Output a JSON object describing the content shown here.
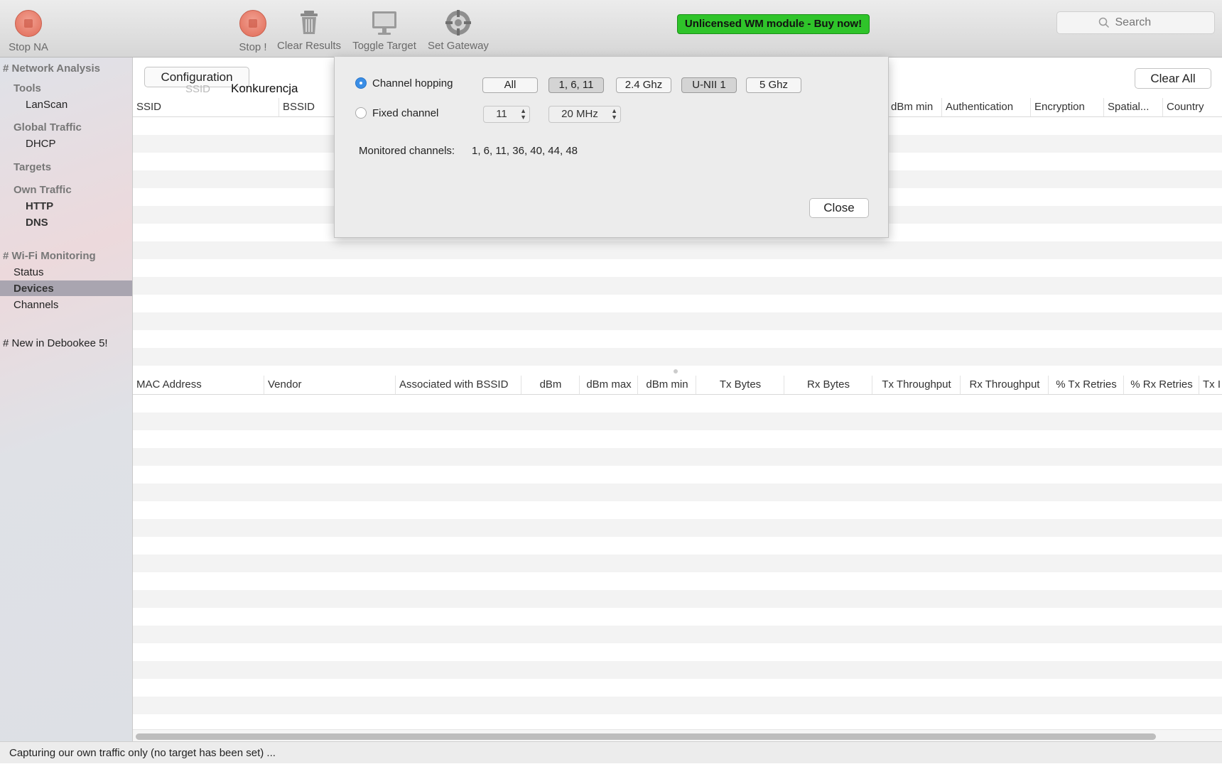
{
  "toolbar": {
    "stop_na": "Stop NA",
    "stop": "Stop !",
    "clear_results": "Clear Results",
    "toggle_target": "Toggle Target",
    "set_gateway": "Set Gateway",
    "license_banner": "Unlicensed WM module - Buy now!",
    "search_placeholder": "Search"
  },
  "sidebar": {
    "network_analysis": "# Network Analysis",
    "tools": "Tools",
    "lanscan": "LanScan",
    "global_traffic": "Global Traffic",
    "dhcp": "DHCP",
    "targets": "Targets",
    "own_traffic": "Own Traffic",
    "http": "HTTP",
    "dns": "DNS",
    "wifi_monitoring": "# Wi-Fi Monitoring",
    "status": "Status",
    "devices": "Devices",
    "channels": "Channels",
    "new_in": "# New in Debookee 5!"
  },
  "main": {
    "configuration": "Configuration",
    "clear_all": "Clear All",
    "tab_ssid": "SSID",
    "tab_name": "Konkurencja",
    "top_table": {
      "columns": [
        "SSID",
        "BSSID",
        "dBm min",
        "Authentication",
        "Encryption",
        "Spatial...",
        "Country"
      ]
    },
    "bottom_table": {
      "columns": [
        "MAC Address",
        "Vendor",
        "Associated with BSSID",
        "dBm",
        "dBm max",
        "dBm min",
        "Tx Bytes",
        "Rx Bytes",
        "Tx Throughput",
        "Rx Throughput",
        "% Tx Retries",
        "% Rx Retries",
        "Tx I"
      ]
    }
  },
  "popover": {
    "channel_hopping": "Channel hopping",
    "fixed_channel": "Fixed channel",
    "chips": [
      "All",
      "1, 6, 11",
      "2.4 Ghz",
      "U-NII 1",
      "5 Ghz"
    ],
    "channel_value": "11",
    "width_value": "20 MHz",
    "monitored_label": "Monitored channels:",
    "monitored_value": "1, 6, 11, 36, 40, 44, 48",
    "close": "Close"
  },
  "status_bar": "Capturing our own traffic only (no target has been set) ...",
  "colors": {
    "license_banner_bg": "#2fc42a",
    "radio_selected": "#3a8ee6",
    "sidebar_selected": "#a9a5b0"
  }
}
